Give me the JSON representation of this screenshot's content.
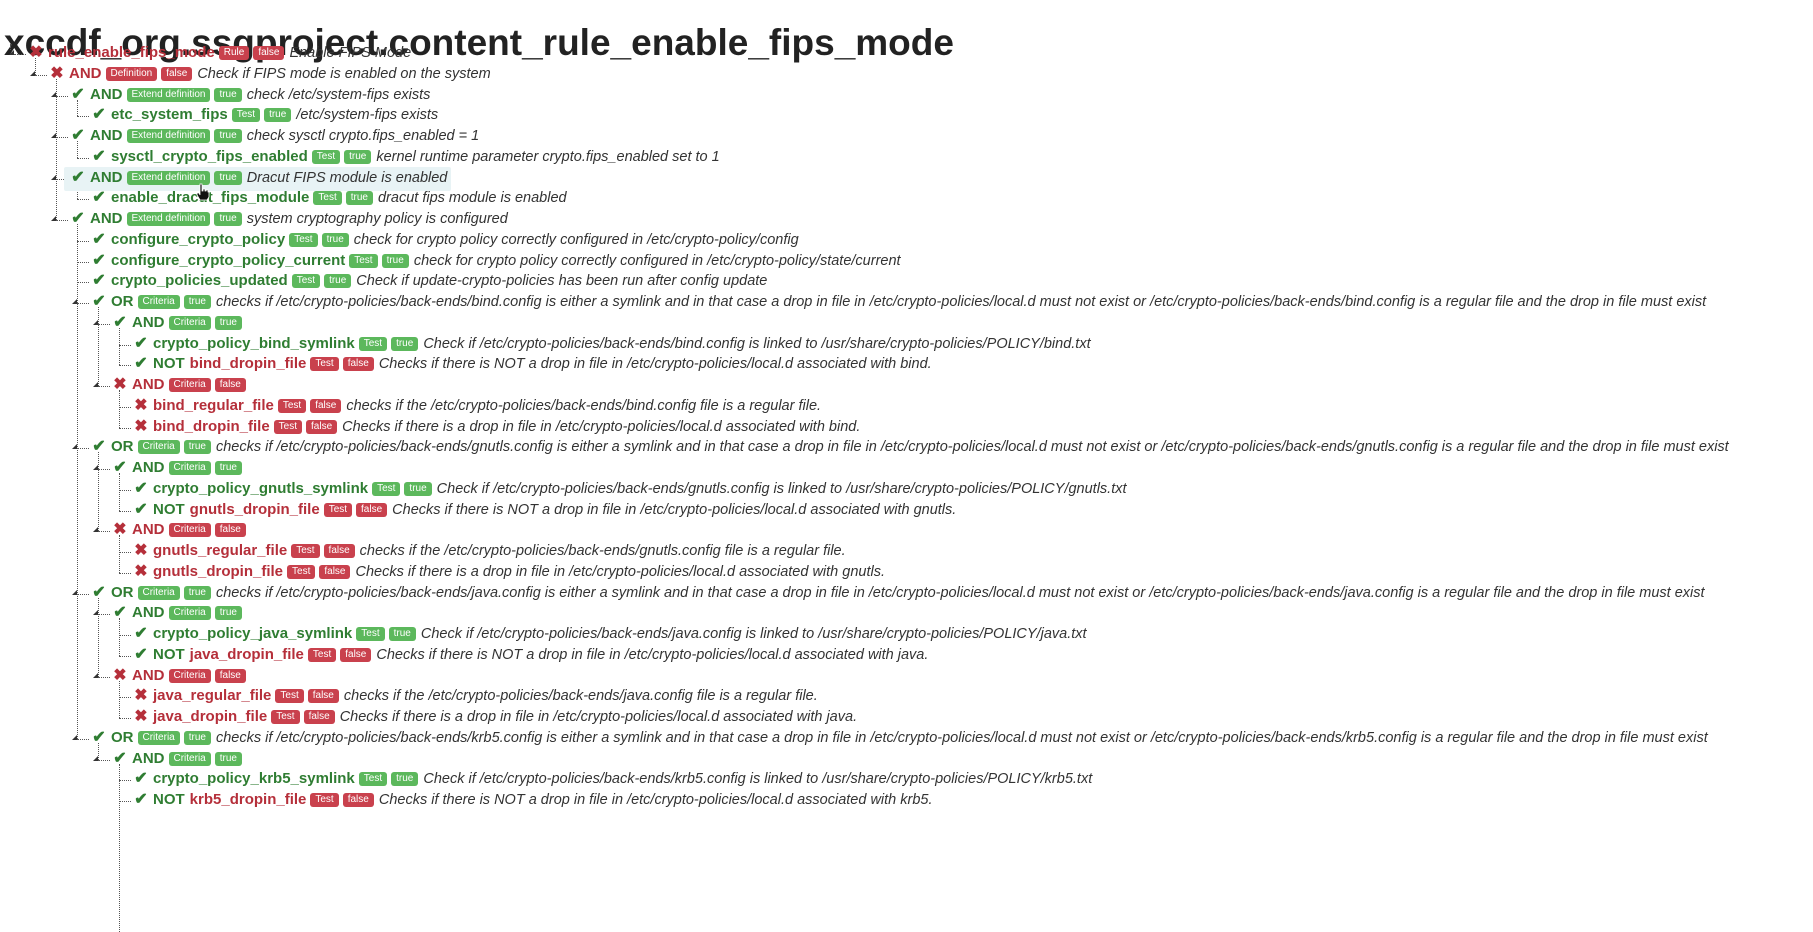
{
  "page_title": "xccdf_org.ssgproject.content_rule_enable_fips_mode",
  "colors": {
    "pass": "#2f7d32",
    "fail": "#b52f3a",
    "badge_green": "#5cb85c",
    "badge_red": "#c9414d",
    "highlight": "#e8f3f5"
  },
  "rows": [
    {
      "depth": 0,
      "status": "fail",
      "name": "rule_enable_fips_mode",
      "badges": [
        "Rule",
        "false"
      ],
      "desc": "Enable FIPS Mode",
      "expandable": true
    },
    {
      "depth": 1,
      "status": "fail",
      "op": "AND",
      "badges": [
        "Definition",
        "false"
      ],
      "desc": "Check if FIPS mode is enabled on the system",
      "expandable": true
    },
    {
      "depth": 2,
      "status": "pass",
      "op": "AND",
      "badges": [
        "Extend definition",
        "true"
      ],
      "desc": "check /etc/system-fips exists",
      "expandable": true
    },
    {
      "depth": 3,
      "status": "pass",
      "name": "etc_system_fips",
      "badges": [
        "Test",
        "true"
      ],
      "desc": "/etc/system-fips exists"
    },
    {
      "depth": 2,
      "status": "pass",
      "op": "AND",
      "badges": [
        "Extend definition",
        "true"
      ],
      "desc": "check sysctl crypto.fips_enabled = 1",
      "expandable": true
    },
    {
      "depth": 3,
      "status": "pass",
      "name": "sysctl_crypto_fips_enabled",
      "badges": [
        "Test",
        "true"
      ],
      "desc": "kernel runtime parameter crypto.fips_enabled set to 1"
    },
    {
      "depth": 2,
      "status": "pass",
      "op": "AND",
      "badges": [
        "Extend definition",
        "true"
      ],
      "desc": "Dracut FIPS module is enabled",
      "expandable": true,
      "highlight": true
    },
    {
      "depth": 3,
      "status": "pass",
      "name": "enable_dracut_fips_module",
      "badges": [
        "Test",
        "true"
      ],
      "desc": "dracut fips module is enabled"
    },
    {
      "depth": 2,
      "status": "pass",
      "op": "AND",
      "badges": [
        "Extend definition",
        "true"
      ],
      "desc": "system cryptography policy is configured",
      "expandable": true
    },
    {
      "depth": 3,
      "status": "pass",
      "name": "configure_crypto_policy",
      "badges": [
        "Test",
        "true"
      ],
      "desc": "check for crypto policy correctly configured in /etc/crypto-policy/config"
    },
    {
      "depth": 3,
      "status": "pass",
      "name": "configure_crypto_policy_current",
      "badges": [
        "Test",
        "true"
      ],
      "desc": "check for crypto policy correctly configured in /etc/crypto-policy/state/current"
    },
    {
      "depth": 3,
      "status": "pass",
      "name": "crypto_policies_updated",
      "badges": [
        "Test",
        "true"
      ],
      "desc": "Check if update-crypto-policies has been run after config update"
    },
    {
      "depth": 3,
      "status": "pass",
      "op": "OR",
      "badges": [
        "Criteria",
        "true"
      ],
      "desc": "checks if /etc/crypto-policies/back-ends/bind.config is either a symlink and in that case a drop in file in /etc/crypto-policies/local.d must not exist or /etc/crypto-policies/back-ends/bind.config is a regular file and the drop in file must exist",
      "expandable": true
    },
    {
      "depth": 4,
      "status": "pass",
      "op": "AND",
      "badges": [
        "Criteria",
        "true"
      ],
      "desc": "",
      "expandable": true
    },
    {
      "depth": 5,
      "status": "pass",
      "name": "crypto_policy_bind_symlink",
      "badges": [
        "Test",
        "true"
      ],
      "desc": "Check if /etc/crypto-policies/back-ends/bind.config is linked to /usr/share/crypto-policies/POLICY/bind.txt"
    },
    {
      "depth": 5,
      "status": "pass",
      "neg": "NOT",
      "name": "bind_dropin_file",
      "name_status": "fail",
      "badges": [
        "Test",
        "false"
      ],
      "desc": "Checks if there is NOT a drop in file in /etc/crypto-policies/local.d associated with bind."
    },
    {
      "depth": 4,
      "status": "fail",
      "op": "AND",
      "badges": [
        "Criteria",
        "false"
      ],
      "desc": "",
      "expandable": true
    },
    {
      "depth": 5,
      "status": "fail",
      "name": "bind_regular_file",
      "badges": [
        "Test",
        "false"
      ],
      "desc": "checks if the /etc/crypto-policies/back-ends/bind.config file is a regular file."
    },
    {
      "depth": 5,
      "status": "fail",
      "name": "bind_dropin_file",
      "badges": [
        "Test",
        "false"
      ],
      "desc": "Checks if there is a drop in file in /etc/crypto-policies/local.d associated with bind."
    },
    {
      "depth": 3,
      "status": "pass",
      "op": "OR",
      "badges": [
        "Criteria",
        "true"
      ],
      "desc": "checks if /etc/crypto-policies/back-ends/gnutls.config is either a symlink and in that case a drop in file in /etc/crypto-policies/local.d must not exist or /etc/crypto-policies/back-ends/gnutls.config is a regular file and the drop in file must exist",
      "expandable": true
    },
    {
      "depth": 4,
      "status": "pass",
      "op": "AND",
      "badges": [
        "Criteria",
        "true"
      ],
      "desc": "",
      "expandable": true
    },
    {
      "depth": 5,
      "status": "pass",
      "name": "crypto_policy_gnutls_symlink",
      "badges": [
        "Test",
        "true"
      ],
      "desc": "Check if /etc/crypto-policies/back-ends/gnutls.config is linked to /usr/share/crypto-policies/POLICY/gnutls.txt"
    },
    {
      "depth": 5,
      "status": "pass",
      "neg": "NOT",
      "name": "gnutls_dropin_file",
      "name_status": "fail",
      "badges": [
        "Test",
        "false"
      ],
      "desc": "Checks if there is NOT a drop in file in /etc/crypto-policies/local.d associated with gnutls."
    },
    {
      "depth": 4,
      "status": "fail",
      "op": "AND",
      "badges": [
        "Criteria",
        "false"
      ],
      "desc": "",
      "expandable": true
    },
    {
      "depth": 5,
      "status": "fail",
      "name": "gnutls_regular_file",
      "badges": [
        "Test",
        "false"
      ],
      "desc": "checks if the /etc/crypto-policies/back-ends/gnutls.config file is a regular file."
    },
    {
      "depth": 5,
      "status": "fail",
      "name": "gnutls_dropin_file",
      "badges": [
        "Test",
        "false"
      ],
      "desc": "Checks if there is a drop in file in /etc/crypto-policies/local.d associated with gnutls."
    },
    {
      "depth": 3,
      "status": "pass",
      "op": "OR",
      "badges": [
        "Criteria",
        "true"
      ],
      "desc": "checks if /etc/crypto-policies/back-ends/java.config is either a symlink and in that case a drop in file in /etc/crypto-policies/local.d must not exist or /etc/crypto-policies/back-ends/java.config is a regular file and the drop in file must exist",
      "expandable": true
    },
    {
      "depth": 4,
      "status": "pass",
      "op": "AND",
      "badges": [
        "Criteria",
        "true"
      ],
      "desc": "",
      "expandable": true
    },
    {
      "depth": 5,
      "status": "pass",
      "name": "crypto_policy_java_symlink",
      "badges": [
        "Test",
        "true"
      ],
      "desc": "Check if /etc/crypto-policies/back-ends/java.config is linked to /usr/share/crypto-policies/POLICY/java.txt"
    },
    {
      "depth": 5,
      "status": "pass",
      "neg": "NOT",
      "name": "java_dropin_file",
      "name_status": "fail",
      "badges": [
        "Test",
        "false"
      ],
      "desc": "Checks if there is NOT a drop in file in /etc/crypto-policies/local.d associated with java."
    },
    {
      "depth": 4,
      "status": "fail",
      "op": "AND",
      "badges": [
        "Criteria",
        "false"
      ],
      "desc": "",
      "expandable": true
    },
    {
      "depth": 5,
      "status": "fail",
      "name": "java_regular_file",
      "badges": [
        "Test",
        "false"
      ],
      "desc": "checks if the /etc/crypto-policies/back-ends/java.config file is a regular file."
    },
    {
      "depth": 5,
      "status": "fail",
      "name": "java_dropin_file",
      "badges": [
        "Test",
        "false"
      ],
      "desc": "Checks if there is a drop in file in /etc/crypto-policies/local.d associated with java."
    },
    {
      "depth": 3,
      "status": "pass",
      "op": "OR",
      "badges": [
        "Criteria",
        "true"
      ],
      "desc": "checks if /etc/crypto-policies/back-ends/krb5.config is either a symlink and in that case a drop in file in /etc/crypto-policies/local.d must not exist or /etc/crypto-policies/back-ends/krb5.config is a regular file and the drop in file must exist",
      "expandable": true
    },
    {
      "depth": 4,
      "status": "pass",
      "op": "AND",
      "badges": [
        "Criteria",
        "true"
      ],
      "desc": "",
      "expandable": true
    },
    {
      "depth": 5,
      "status": "pass",
      "name": "crypto_policy_krb5_symlink",
      "badges": [
        "Test",
        "true"
      ],
      "desc": "Check if /etc/crypto-policies/back-ends/krb5.config is linked to /usr/share/crypto-policies/POLICY/krb5.txt"
    },
    {
      "depth": 5,
      "status": "pass",
      "neg": "NOT",
      "name": "krb5_dropin_file",
      "name_status": "fail",
      "badges": [
        "Test",
        "false"
      ],
      "desc": "Checks if there is NOT a drop in file in /etc/crypto-policies/local.d associated with krb5."
    }
  ]
}
